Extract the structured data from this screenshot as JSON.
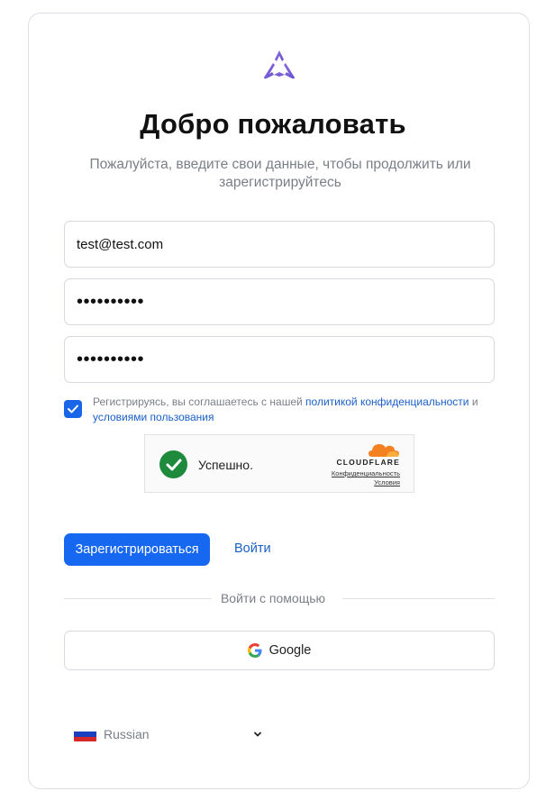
{
  "header": {
    "logo_icon": "triangle-logo-icon",
    "title": "Добро пожаловать",
    "subtitle": "Пожалуйста, введите свои данные, чтобы продолжить или зарегистрируйтесь"
  },
  "form": {
    "email_value": "test@test.com",
    "password_value": "••••••••••",
    "confirm_password_value": "••••••••••"
  },
  "consent": {
    "checked": true,
    "text_before": "Регистрируясь, вы соглашаетесь с нашей ",
    "privacy_link": "политикой конфиденциальности",
    "text_and": " и ",
    "terms_link": "условиями пользования"
  },
  "captcha": {
    "status": "Успешно.",
    "brand": "CLOUDFLARE",
    "privacy_link": "Конфиденциальность",
    "terms_link": "Условия"
  },
  "actions": {
    "register_label": "Зарегистрироваться",
    "login_label": "Войти"
  },
  "social": {
    "divider_text": "Войти с помощью",
    "google_label": "Google"
  },
  "language": {
    "selected": "Russian"
  },
  "colors": {
    "primary": "#1668f0",
    "link": "#1a5fc8",
    "success": "#1e8b3c",
    "logo": "#7b5bd6"
  }
}
